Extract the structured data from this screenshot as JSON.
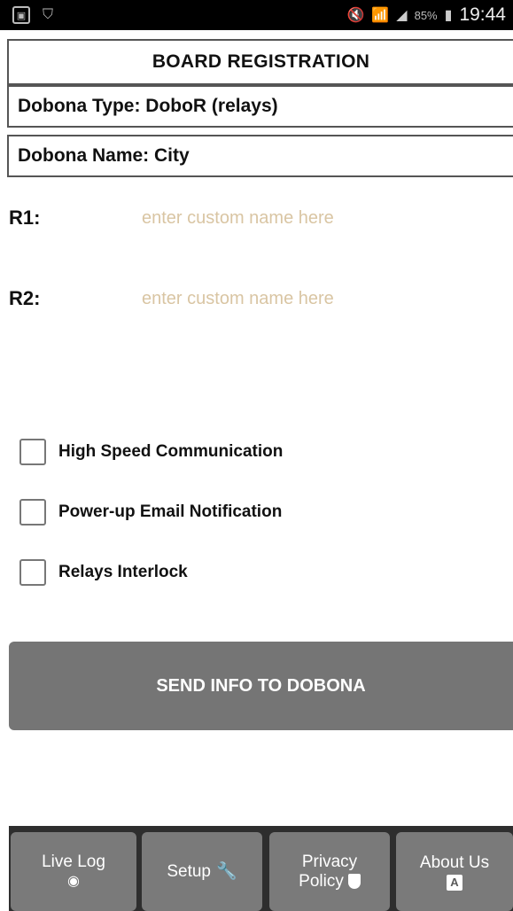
{
  "status_bar": {
    "battery": "85%",
    "time": "19:44"
  },
  "title": "BOARD REGISTRATION",
  "dobona_type": "Dobona Type: DoboR (relays)",
  "dobona_name": "Dobona Name: City",
  "relays": [
    {
      "label": "R1:",
      "value": "",
      "placeholder": "enter custom name here"
    },
    {
      "label": "R2:",
      "value": "",
      "placeholder": "enter custom name here"
    }
  ],
  "options": [
    {
      "label": "High Speed Communication",
      "checked": false
    },
    {
      "label": "Power-up Email Notification",
      "checked": false
    },
    {
      "label": "Relays Interlock",
      "checked": false
    }
  ],
  "send_button": "SEND INFO TO DOBONA",
  "nav": {
    "live_log": {
      "line1": "Live Log",
      "icon": "eye-icon"
    },
    "setup": {
      "label": "Setup",
      "icon": "wrench-icon"
    },
    "privacy": {
      "line1": "Privacy",
      "line2": "Policy",
      "icon": "shield-icon"
    },
    "about": {
      "line1": "About Us",
      "icon_letter": "A",
      "icon": "about-icon"
    }
  },
  "colors": {
    "button_gray": "#757575",
    "nav_bar": "#2e2e2e",
    "placeholder": "#d9c5a3"
  }
}
